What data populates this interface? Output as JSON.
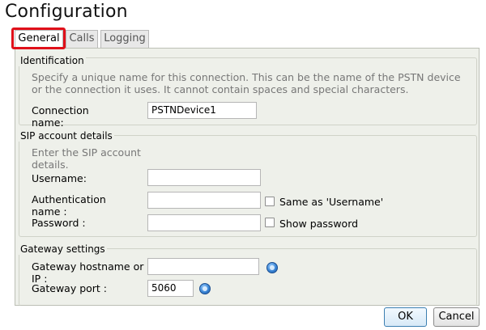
{
  "page": {
    "title": "Configuration"
  },
  "tabs": [
    {
      "label": "General",
      "active": true
    },
    {
      "label": "Calls",
      "active": false
    },
    {
      "label": "Logging",
      "active": false
    }
  ],
  "identification": {
    "legend": "Identification",
    "description": "Specify a unique name for this connection. This can be the name of the PSTN device or the connection it uses. It cannot contain spaces and special characters.",
    "connection_name_label": "Connection name:",
    "connection_name_value": "PSTNDevice1"
  },
  "sip": {
    "legend": "SIP account details",
    "description": "Enter the SIP account details.",
    "username_label": "Username:",
    "username_value": "",
    "auth_label": "Authentication name :",
    "auth_value": "",
    "same_as_label": "Same as 'Username'",
    "same_as_checked": false,
    "password_label": "Password :",
    "password_value": "",
    "show_password_label": "Show password",
    "show_password_checked": false
  },
  "gateway": {
    "legend": "Gateway settings",
    "hostname_label": "Gateway hostname or IP :",
    "hostname_value": "",
    "port_label": "Gateway port :",
    "port_value": "5060",
    "info_icon": "info-icon"
  },
  "footer": {
    "ok_label": "OK",
    "cancel_label": "Cancel"
  },
  "colors": {
    "tab_highlight": "#e0101a",
    "panel_bg": "#eef0ea",
    "info_icon": "#3b86d6"
  }
}
